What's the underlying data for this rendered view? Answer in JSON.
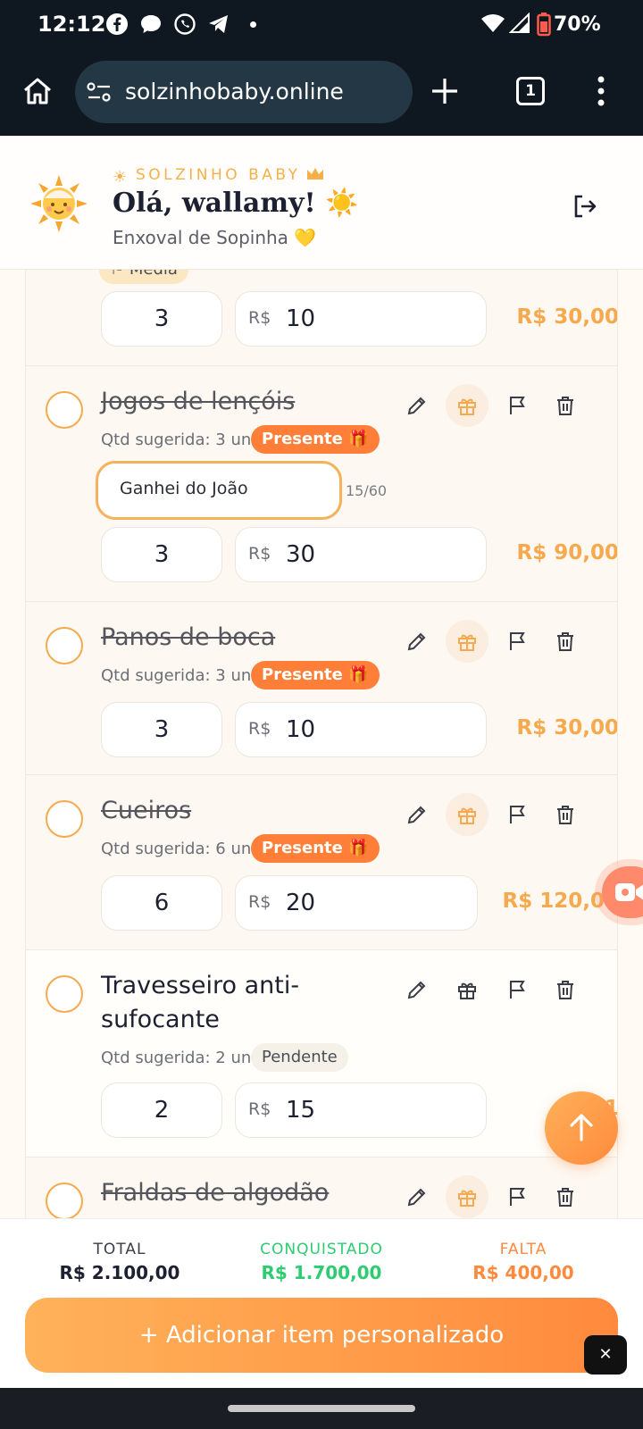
{
  "status": {
    "time": "12:12",
    "battery": "70%"
  },
  "browser": {
    "url": "solzinhobaby.online",
    "tabs": "1"
  },
  "header": {
    "brand": "SOLZINHO BABY",
    "greeting": "Olá, wallamy! ☀️",
    "subtitle": "Enxoval de Sopinha 💛"
  },
  "items": [
    {
      "tag": "⚐ Média",
      "qty": "3",
      "currency": "R$",
      "price": "10",
      "total": "R$ 30,00"
    },
    {
      "name": "Jogos de lençóis",
      "suggested": "Qtd sugerida: 3 un",
      "tag": "Presente 🎁",
      "note": "Ganhei do João",
      "note_count": "15/60",
      "qty": "3",
      "currency": "R$",
      "price": "30",
      "total": "R$ 90,00"
    },
    {
      "name": "Panos de boca",
      "suggested": "Qtd sugerida: 3 un",
      "tag": "Presente 🎁",
      "qty": "3",
      "currency": "R$",
      "price": "10",
      "total": "R$ 30,00"
    },
    {
      "name": "Cueiros",
      "suggested": "Qtd sugerida: 6 un",
      "tag": "Presente 🎁",
      "qty": "6",
      "currency": "R$",
      "price": "20",
      "total": "R$ 120,00"
    },
    {
      "name_line1": "Travesseiro anti-",
      "name_line2": "sufocante",
      "suggested": "Qtd sugerida: 2 un",
      "tag": "Pendente",
      "qty": "2",
      "currency": "R$",
      "price": "15",
      "total": "R$ 1"
    },
    {
      "name": "Fraldas de algodão"
    }
  ],
  "summary": {
    "total_label": "TOTAL",
    "total_value": "R$ 2.100,00",
    "won_label": "CONQUISTADO",
    "won_value": "R$ 1.700,00",
    "missing_label": "FALTA",
    "missing_value": "R$ 400,00"
  },
  "add_button": "+ Adicionar item personalizado",
  "colors": {
    "accent": "#ff8a3d",
    "gold": "#f6a94d",
    "green": "#2ecc71",
    "dark": "#0f1720"
  }
}
